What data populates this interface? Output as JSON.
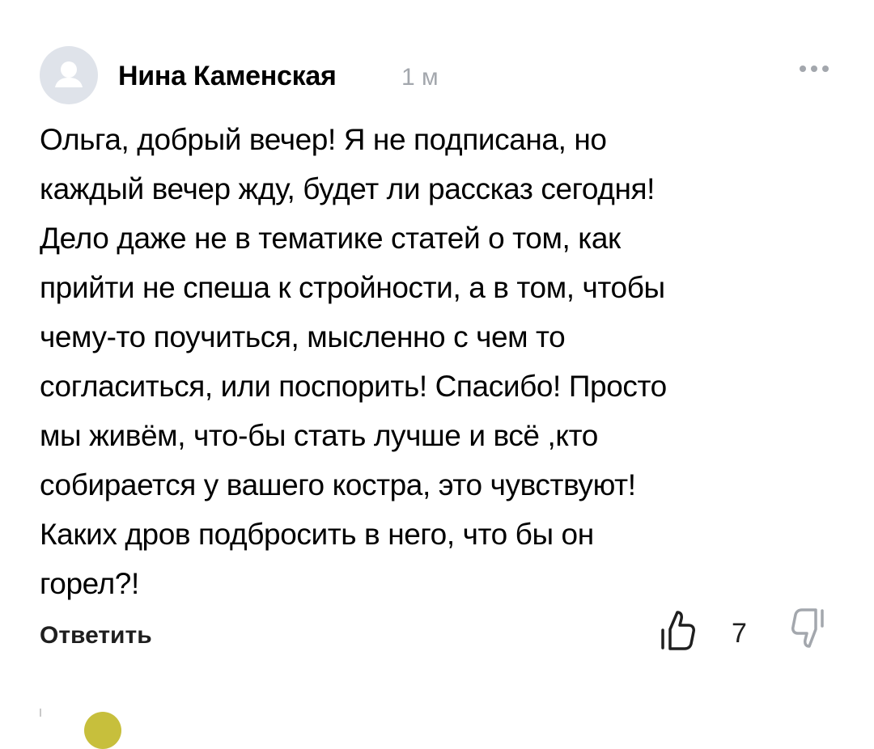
{
  "comment": {
    "author": "Нина Каменская",
    "time": "1 м",
    "text": "Ольга, добрый вечер! Я не подписана, но\nкаждый вечер жду, будет ли рассказ сегодня!\nДело даже не в тематике статей о том, как\nприйти не спеша к стройности, а в том, чтобы\nчему-то поучиться, мысленно с чем то\nсогласиться, или поспорить! Спасибо! Просто\nмы живём, что-бы стать лучше и всё ,кто\nсобирается у вашего костра, это чувствуют!\nКаких дров подбросить в него, что бы он\nгорел?!",
    "reply_label": "Ответить",
    "likes": "7",
    "icons": {
      "avatar": "user-avatar-placeholder",
      "more": "more-dots-icon",
      "like": "thumbs-up-icon",
      "dislike": "thumbs-down-icon"
    }
  },
  "colors": {
    "text": "#000000",
    "muted": "#a3a7ad",
    "avatar_bg": "#dfe3ea",
    "avatar_fg": "#ffffff"
  }
}
